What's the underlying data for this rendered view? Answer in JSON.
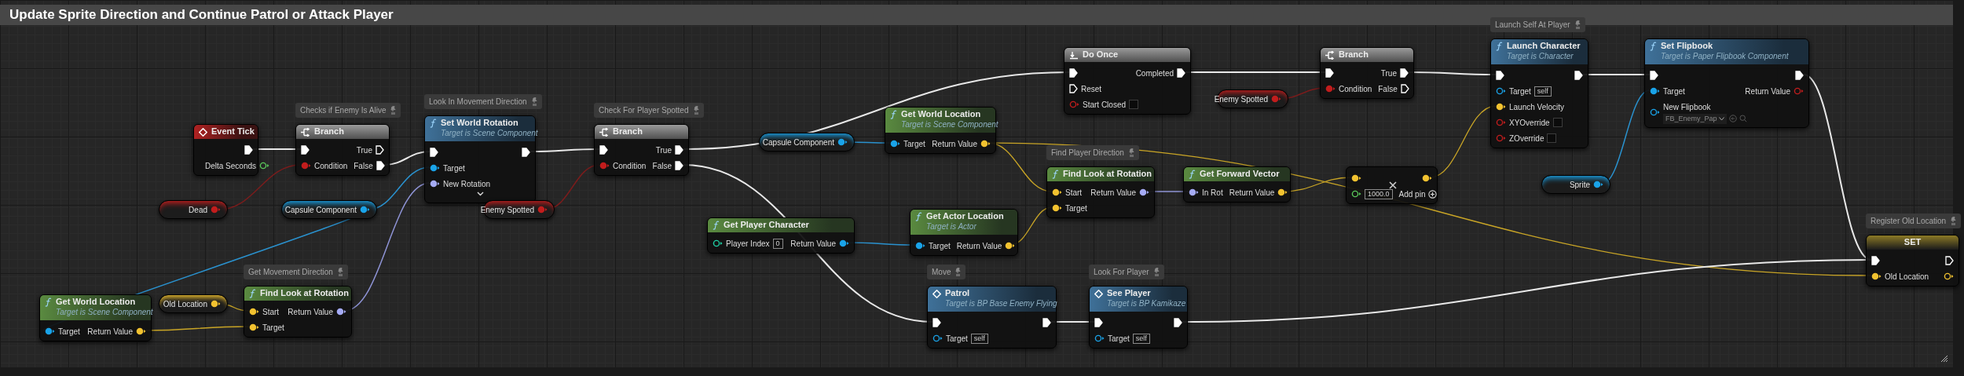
{
  "comment_box": {
    "title": "Update Sprite Direction and Continue Patrol or Attack Player"
  },
  "nodes": [
    {
      "kind": "event",
      "title": "Event Tick",
      "outputs": [
        {
          "kind": "exec",
          "connected": true
        },
        {
          "label": "Delta Seconds",
          "kind": "float",
          "connected": false
        }
      ]
    },
    {
      "kind": "flow",
      "title": "Branch",
      "comment": "Checks if Enemy Is Alive",
      "inputs": [
        {
          "kind": "exec",
          "connected": true
        },
        {
          "label": "Condition",
          "kind": "bool",
          "connected": true
        }
      ],
      "outputs": [
        {
          "label": "True",
          "kind": "exec",
          "connected": false
        },
        {
          "label": "False",
          "kind": "exec",
          "connected": true
        }
      ]
    },
    {
      "kind": "variable",
      "title": "Dead",
      "outputs": [
        {
          "kind": "bool",
          "connected": true
        }
      ]
    },
    {
      "kind": "variable",
      "title": "Capsule Component",
      "outputs": [
        {
          "kind": "object",
          "connected": true
        }
      ]
    },
    {
      "kind": "pure",
      "title": "Get World Location",
      "subtitle": "Target is Scene Component",
      "inputs": [
        {
          "label": "Target",
          "kind": "object",
          "connected": true
        }
      ],
      "outputs": [
        {
          "label": "Return Value",
          "kind": "vector",
          "connected": true
        }
      ]
    },
    {
      "kind": "variable",
      "title": "Old Location",
      "outputs": [
        {
          "kind": "vector",
          "connected": true
        }
      ]
    },
    {
      "kind": "pure",
      "title": "Find Look at Rotation",
      "comment": "Get Movement Direction",
      "inputs": [
        {
          "label": "Start",
          "kind": "vector",
          "connected": true
        },
        {
          "label": "Target",
          "kind": "vector",
          "connected": true
        }
      ],
      "outputs": [
        {
          "label": "Return Value",
          "kind": "rotator",
          "connected": true
        }
      ]
    },
    {
      "kind": "call",
      "title": "Set World Rotation",
      "subtitle": "Target is Scene Component",
      "comment": "Look In Movement Direction",
      "advanced_collapsed": true,
      "inputs": [
        {
          "kind": "exec",
          "connected": true
        },
        {
          "label": "Target",
          "kind": "object",
          "connected": true
        },
        {
          "label": "New Rotation",
          "kind": "rotator",
          "connected": true
        }
      ],
      "outputs": [
        {
          "kind": "exec",
          "connected": true
        }
      ]
    },
    {
      "kind": "variable",
      "title": "Enemy Spotted",
      "outputs": [
        {
          "kind": "bool",
          "connected": true
        }
      ]
    },
    {
      "kind": "flow",
      "title": "Branch",
      "comment": "Check For Player Spotted",
      "inputs": [
        {
          "kind": "exec",
          "connected": true
        },
        {
          "label": "Condition",
          "kind": "bool",
          "connected": true
        }
      ],
      "outputs": [
        {
          "label": "True",
          "kind": "exec",
          "connected": true
        },
        {
          "label": "False",
          "kind": "exec",
          "connected": true
        }
      ]
    },
    {
      "kind": "variable",
      "title": "Capsule Component",
      "outputs": [
        {
          "kind": "object",
          "connected": true
        }
      ]
    },
    {
      "kind": "pure",
      "title": "Get World Location",
      "subtitle": "Target is Scene Component",
      "inputs": [
        {
          "label": "Target",
          "kind": "object",
          "connected": true
        }
      ],
      "outputs": [
        {
          "label": "Return Value",
          "kind": "vector",
          "connected": true
        }
      ]
    },
    {
      "kind": "pure",
      "title": "Get Player Character",
      "inputs": [
        {
          "label": "Player Index",
          "kind": "int",
          "connected": false,
          "value": "0"
        }
      ],
      "outputs": [
        {
          "label": "Return Value",
          "kind": "object",
          "connected": true
        }
      ]
    },
    {
      "kind": "pure",
      "title": "Get Actor Location",
      "subtitle": "Target is Actor",
      "inputs": [
        {
          "label": "Target",
          "kind": "object",
          "connected": true
        }
      ],
      "outputs": [
        {
          "label": "Return Value",
          "kind": "vector",
          "connected": true
        }
      ]
    },
    {
      "kind": "custom_call",
      "title": "Patrol",
      "subtitle": "Target is BP Base Enemy Flying",
      "comment": "Move",
      "inputs": [
        {
          "kind": "exec",
          "connected": true
        },
        {
          "label": "Target",
          "kind": "object",
          "connected": false,
          "value": "self"
        }
      ],
      "outputs": [
        {
          "kind": "exec",
          "connected": true
        }
      ]
    },
    {
      "kind": "macro",
      "title": "Do Once",
      "inputs": [
        {
          "kind": "exec",
          "connected": true
        },
        {
          "label": "Reset",
          "kind": "exec",
          "connected": false
        },
        {
          "label": "Start Closed",
          "kind": "bool",
          "connected": false,
          "checked": false
        }
      ],
      "outputs": [
        {
          "label": "Completed",
          "kind": "exec",
          "connected": true
        }
      ]
    },
    {
      "kind": "variable",
      "title": "Enemy Spotted",
      "outputs": [
        {
          "kind": "bool",
          "connected": true
        }
      ]
    },
    {
      "kind": "flow",
      "title": "Branch",
      "inputs": [
        {
          "kind": "exec",
          "connected": true
        },
        {
          "label": "Condition",
          "kind": "bool",
          "connected": true
        }
      ],
      "outputs": [
        {
          "label": "True",
          "kind": "exec",
          "connected": true
        },
        {
          "label": "False",
          "kind": "exec",
          "connected": false
        }
      ]
    },
    {
      "kind": "pure",
      "title": "Find Look at Rotation",
      "comment": "Find Player Direction",
      "inputs": [
        {
          "label": "Start",
          "kind": "vector",
          "connected": true
        },
        {
          "label": "Target",
          "kind": "vector",
          "connected": true
        }
      ],
      "outputs": [
        {
          "label": "Return Value",
          "kind": "rotator",
          "connected": true
        }
      ]
    },
    {
      "kind": "pure",
      "title": "Get Forward Vector",
      "inputs": [
        {
          "label": "In Rot",
          "kind": "rotator",
          "connected": true
        }
      ],
      "outputs": [
        {
          "label": "Return Value",
          "kind": "vector",
          "connected": true
        }
      ]
    },
    {
      "kind": "math",
      "inputs": [
        {
          "kind": "vector",
          "connected": true
        },
        {
          "kind": "float",
          "connected": false,
          "value": "1000.0"
        }
      ],
      "outputs": [
        {
          "kind": "vector",
          "connected": true
        },
        {
          "label": "Add pin",
          "kind": "add"
        }
      ]
    },
    {
      "kind": "custom_call",
      "title": "See Player",
      "subtitle": "Target is BP Kamikaze",
      "comment": "Look For Player",
      "inputs": [
        {
          "kind": "exec",
          "connected": true
        },
        {
          "label": "Target",
          "kind": "object",
          "connected": false,
          "value": "self"
        }
      ],
      "outputs": [
        {
          "kind": "exec",
          "connected": true
        }
      ]
    },
    {
      "kind": "call",
      "title": "Launch Character",
      "subtitle": "Target is Character",
      "comment": "Launch Self At Player",
      "inputs": [
        {
          "kind": "exec",
          "connected": true
        },
        {
          "label": "Target",
          "kind": "object",
          "connected": false,
          "value": "self"
        },
        {
          "label": "Launch Velocity",
          "kind": "vector",
          "connected": true
        },
        {
          "label": "XYOverride",
          "kind": "bool",
          "connected": false,
          "checked": false
        },
        {
          "label": "ZOverride",
          "kind": "bool",
          "connected": false,
          "checked": false
        }
      ],
      "outputs": [
        {
          "kind": "exec",
          "connected": true
        }
      ]
    },
    {
      "kind": "variable",
      "title": "Sprite",
      "outputs": [
        {
          "kind": "object",
          "connected": true
        }
      ]
    },
    {
      "kind": "call",
      "title": "Set Flipbook",
      "subtitle": "Target is Paper Flipbook Component",
      "inputs": [
        {
          "kind": "exec",
          "connected": true
        },
        {
          "label": "Target",
          "kind": "object",
          "connected": true
        },
        {
          "label": "New Flipbook",
          "kind": "object",
          "connected": false,
          "dropdown": "FB_Enemy_Pap"
        }
      ],
      "outputs": [
        {
          "kind": "exec",
          "connected": true
        },
        {
          "label": "Return Value",
          "kind": "bool",
          "connected": false
        }
      ]
    },
    {
      "kind": "set",
      "title": "SET",
      "comment": "Register Old Location",
      "inputs": [
        {
          "kind": "exec",
          "connected": true
        },
        {
          "label": "Old Location",
          "kind": "vector",
          "connected": true
        }
      ],
      "outputs": [
        {
          "kind": "exec",
          "connected": false
        },
        {
          "kind": "vector",
          "connected": false
        }
      ]
    }
  ]
}
